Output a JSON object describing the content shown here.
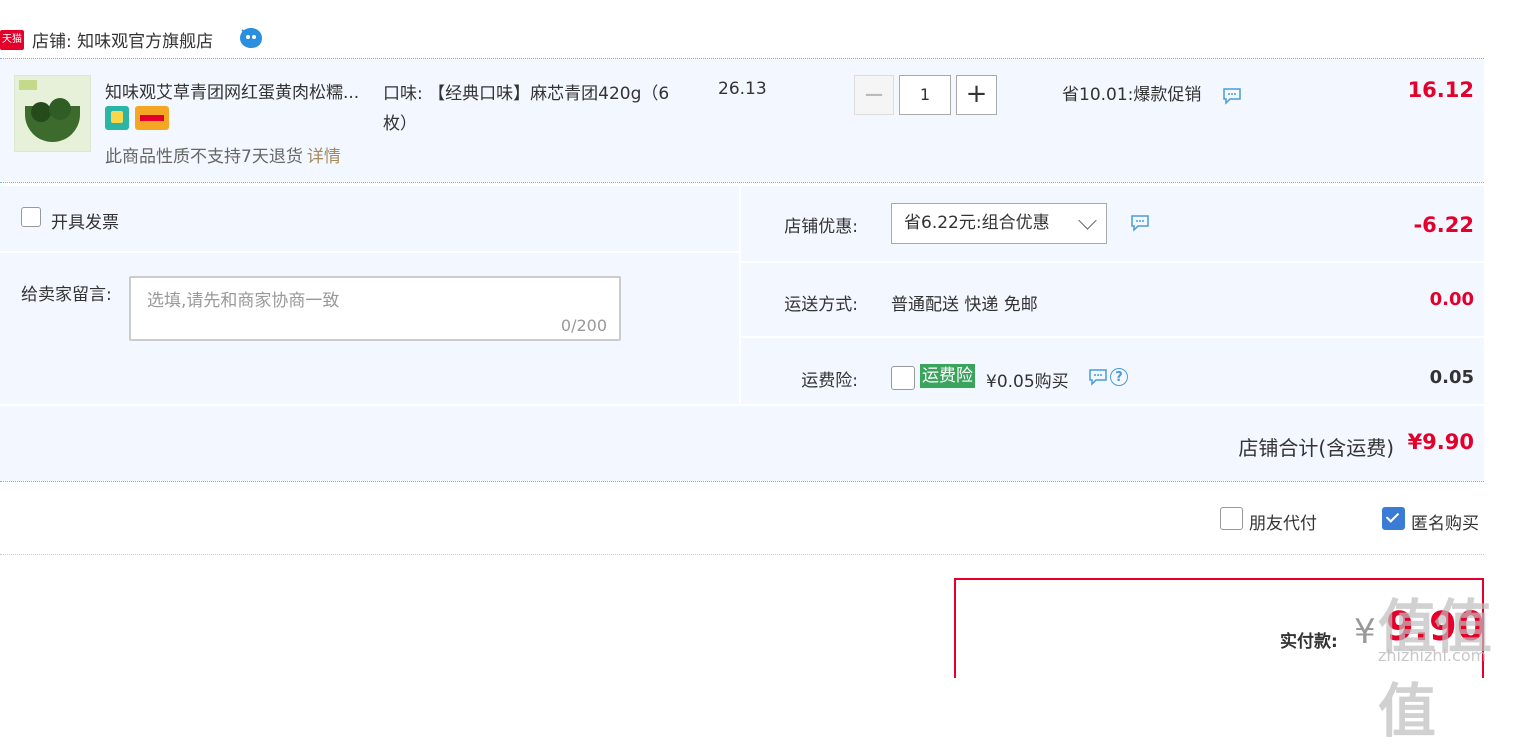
{
  "shop": {
    "badge": "天猫",
    "label": "店铺: 知味观官方旗舰店"
  },
  "item": {
    "title": "知味观艾草青团网红蛋黄肉松糯...",
    "no_return": "此商品性质不支持7天退货",
    "detail_link": "详情",
    "flavor": "口味: 【经典口味】麻芯青团420g（6枚）",
    "price": "26.13",
    "qty_minus": "−",
    "quantity": "1",
    "qty_plus": "+",
    "promo": "省10.01:爆款促销",
    "subtotal": "16.12"
  },
  "invoice": {
    "label": "开具发票"
  },
  "message": {
    "label": "给卖家留言:",
    "placeholder": "选填,请先和商家协商一致",
    "count": "0/200"
  },
  "shop_discount": {
    "label": "店铺优惠:",
    "selected": "省6.22元:组合优惠",
    "value": "-6.22"
  },
  "shipping": {
    "label": "运送方式:",
    "method": "普通配送 快递 免邮",
    "value": "0.00"
  },
  "insurance": {
    "label": "运费险:",
    "tag": "运费险",
    "price": "¥0.05购买",
    "help": "?",
    "value": "0.05"
  },
  "shop_total": {
    "label": "店铺合计(含运费)",
    "value": "¥9.90"
  },
  "options": {
    "friend_pay": "朋友代付",
    "anonymous": "匿名购买"
  },
  "payment": {
    "label": "实付款:",
    "currency": "¥",
    "value": "9.90"
  },
  "watermark": {
    "big": "值值值",
    "small": "zhizhizhi.com"
  },
  "colors": {
    "accent_red": "#e4002b",
    "panel_bg": "#f3f7ff",
    "checkbox_blue": "#3a7bd5",
    "insurance_green": "#3aa45d"
  }
}
